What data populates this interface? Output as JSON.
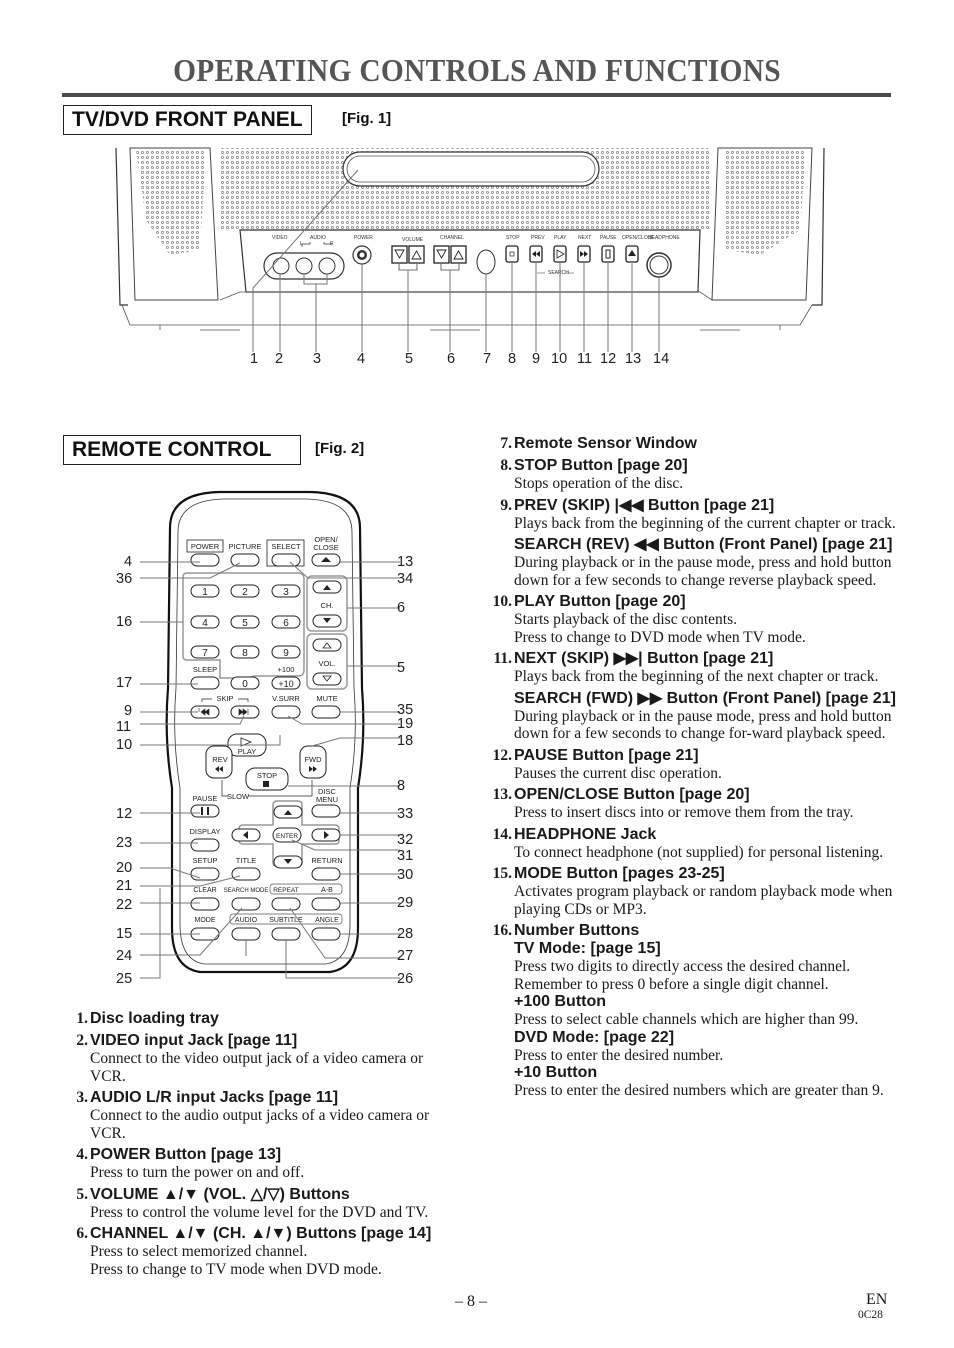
{
  "page_title": "OPERATING CONTROLS AND FUNCTIONS",
  "front_panel": {
    "section_label": "TV/DVD FRONT PANEL",
    "fig_label": "[Fig. 1]",
    "panel_labels": {
      "video": "VIDEO",
      "audio": "AUDIO",
      "audio_l": "L",
      "audio_r": "R",
      "power": "POWER",
      "volume": "VOLUME",
      "channel": "CHANNEL",
      "stop": "STOP",
      "prev": "PREV",
      "play": "PLAY",
      "next": "NEXT",
      "pause": "PAUSE",
      "open_close": "OPEN/CLOSE",
      "headphone": "HEADPHONE",
      "search": "SEARCH"
    },
    "callouts": [
      "1",
      "2",
      "3",
      "4",
      "5",
      "6",
      "7",
      "8",
      "9",
      "10",
      "11",
      "12",
      "13",
      "14"
    ]
  },
  "remote": {
    "section_label": "REMOTE CONTROL",
    "fig_label": "[Fig. 2]",
    "button_labels": {
      "power": "POWER",
      "picture": "PICTURE",
      "select": "SELECT",
      "open_close_1": "OPEN/",
      "open_close_2": "CLOSE",
      "digits": [
        "1",
        "2",
        "3",
        "4",
        "5",
        "6",
        "7",
        "8",
        "9",
        "0"
      ],
      "ch": "CH.",
      "vol": "VOL.",
      "sleep": "SLEEP",
      "plus100": "+100",
      "plus10": "+10",
      "skip": "SKIP",
      "vsurr": "V.SURR",
      "mute": "MUTE",
      "play": "PLAY",
      "rev": "REV",
      "fwd": "FWD",
      "stop": "STOP",
      "pause": "PAUSE",
      "slow": "SLOW",
      "disc_menu_1": "DISC",
      "disc_menu_2": "MENU",
      "display": "DISPLAY",
      "enter": "ENTER",
      "setup": "SETUP",
      "title": "TITLE",
      "return": "RETURN",
      "clear": "CLEAR",
      "search_mode": "SEARCH MODE",
      "repeat": "REPEAT",
      "a_b": "A-B",
      "mode": "MODE",
      "audio": "AUDIO",
      "subtitle": "SUBTITLE",
      "angle": "ANGLE"
    },
    "left_callouts": [
      "4",
      "36",
      "16",
      "17",
      "9",
      "11",
      "10",
      "12",
      "23",
      "20",
      "21",
      "22",
      "15",
      "24",
      "25"
    ],
    "right_callouts": [
      "13",
      "34",
      "6",
      "5",
      "35",
      "19",
      "18",
      "8",
      "33",
      "32",
      "31",
      "30",
      "29",
      "28",
      "27",
      "26"
    ]
  },
  "descriptions_left": [
    {
      "num": "1.",
      "head": "Disc loading tray",
      "lines": []
    },
    {
      "num": "2.",
      "head": "VIDEO input Jack [page 11]",
      "lines": [
        "Connect to the video output jack of a video camera or VCR."
      ]
    },
    {
      "num": "3.",
      "head": "AUDIO L/R input Jacks [page 11]",
      "lines": [
        "Connect to the audio output jacks of a video camera or VCR."
      ]
    },
    {
      "num": "4.",
      "head": "POWER Button [page 13]",
      "lines": [
        "Press to turn the power on and off."
      ]
    },
    {
      "num": "5.",
      "head": "VOLUME ▲/▼ (VOL. △/▽) Buttons",
      "lines": [
        "Press to control the volume level for the DVD and TV."
      ]
    },
    {
      "num": "6.",
      "head": "CHANNEL ▲/▼ (CH. ▲/▼) Buttons [page 14]",
      "lines": [
        "Press to select memorized channel.",
        "Press to change to TV mode when DVD mode."
      ]
    }
  ],
  "descriptions_right": {
    "item7": {
      "num": "7.",
      "head": "Remote Sensor Window"
    },
    "item8": {
      "num": "8.",
      "head": "STOP Button [page 20]",
      "line1": "Stops operation of the disc."
    },
    "item9": {
      "num": "9.",
      "head": "PREV (SKIP) |◀◀ Button [page 21]",
      "line1": "Plays back from the beginning of the current chapter or track.",
      "sub": "SEARCH (REV) ◀◀ Button (Front Panel) [page 21]",
      "line2": "During playback or in the pause mode, press and hold button down for a few seconds to change reverse playback speed."
    },
    "item10": {
      "num": "10.",
      "head": "PLAY Button [page 20]",
      "line1": "Starts playback of the disc contents.",
      "line2": "Press to change to DVD mode when TV mode."
    },
    "item11": {
      "num": "11.",
      "head": "NEXT (SKIP) ▶▶| Button [page 21]",
      "line1": "Plays back from the beginning of the next chapter or track.",
      "sub": "SEARCH (FWD) ▶▶ Button (Front Panel) [page 21]",
      "line2": "During playback or in the pause mode, press and hold button down for a few seconds to change for-ward playback speed."
    },
    "item12": {
      "num": "12.",
      "head": "PAUSE Button [page 21]",
      "line1": "Pauses the current disc operation."
    },
    "item13": {
      "num": "13.",
      "head": "OPEN/CLOSE Button [page 20]",
      "line1": "Press to insert discs into or remove them from the tray."
    },
    "item14": {
      "num": "14.",
      "head": "HEADPHONE Jack",
      "line1": "To connect headphone (not supplied) for personal listening."
    },
    "item15": {
      "num": "15.",
      "head": "MODE Button [pages 23-25]",
      "line1": "Activates program playback or random playback mode when playing CDs or MP3."
    },
    "item16": {
      "num": "16.",
      "head": "Number Buttons",
      "tv_head": "TV Mode: [page 15]",
      "tv_line1": "Press two digits to directly access the desired channel.",
      "tv_line2": "Remember to press 0 before a single digit channel.",
      "plus100_head": "+100 Button",
      "plus100_line": "Press to select cable channels which are higher than 99.",
      "dvd_head": "DVD Mode: [page 22]",
      "dvd_line": "Press to enter the desired number.",
      "plus10_head": "+10 Button",
      "plus10_line": "Press to enter the desired numbers which are greater than 9."
    }
  },
  "footer": {
    "page": "– 8 –",
    "lang": "EN",
    "code": "0C28"
  }
}
